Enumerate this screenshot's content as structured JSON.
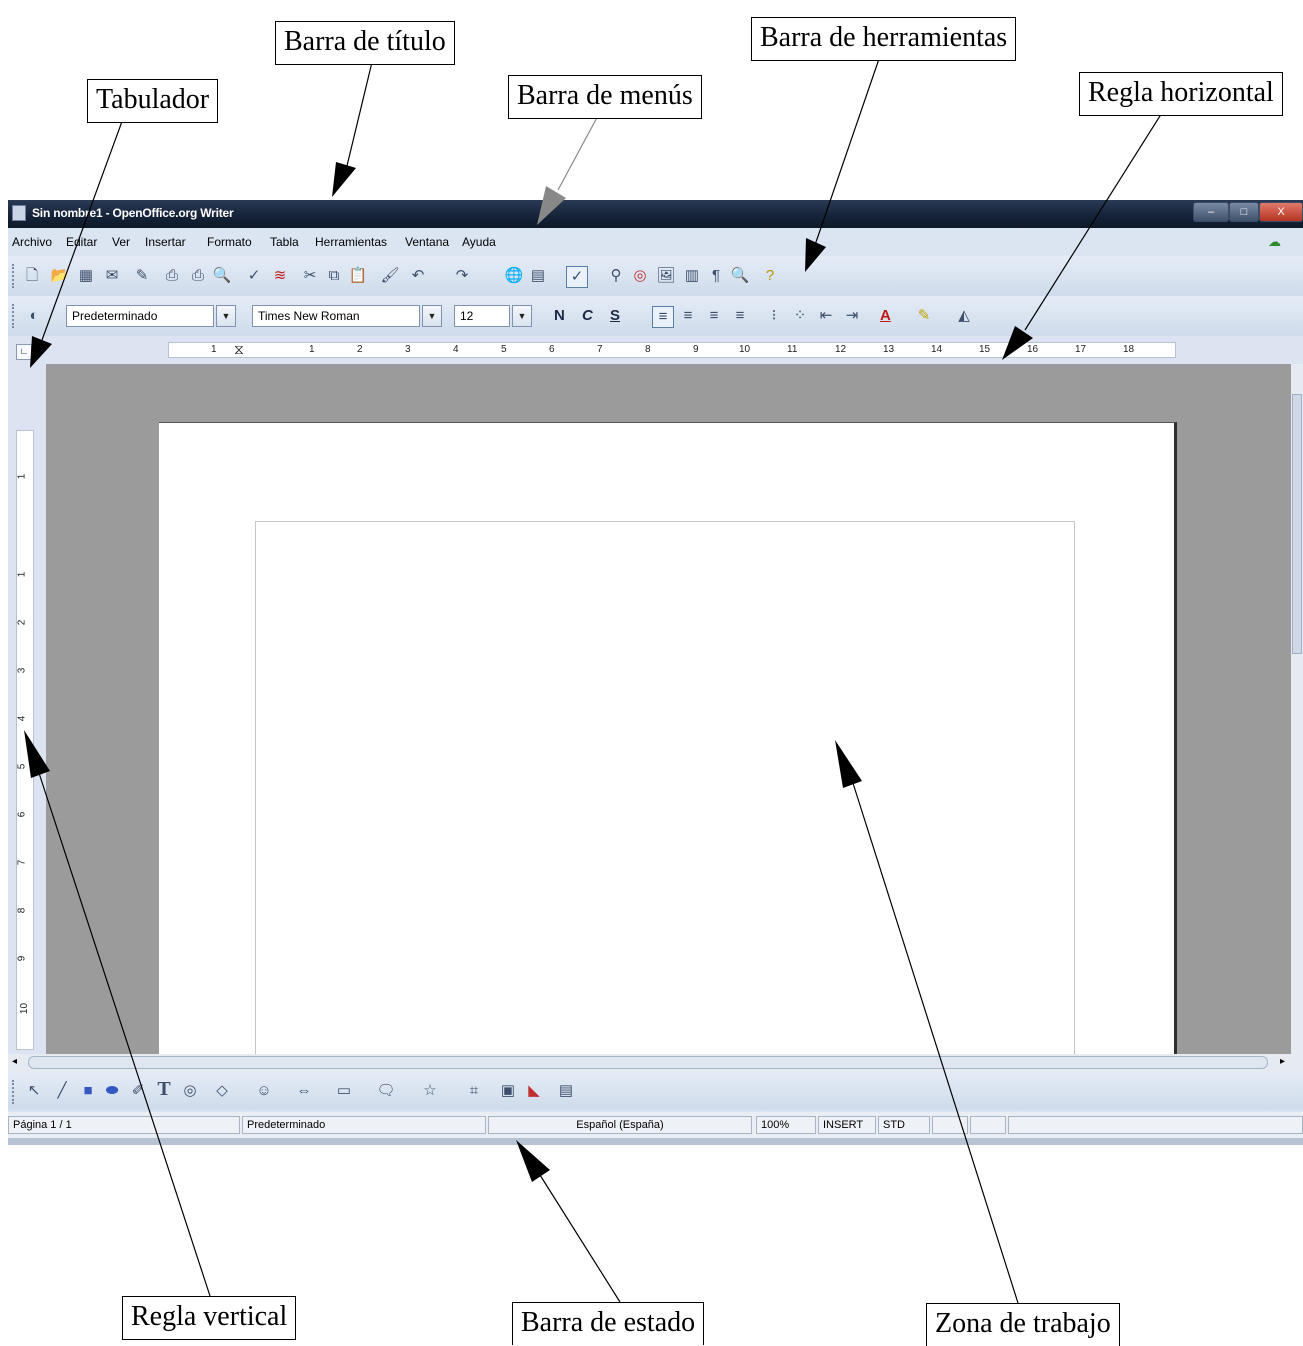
{
  "callouts": {
    "barra_titulo": "Barra de título",
    "barra_herramientas": "Barra de herramientas",
    "tabulador": "Tabulador",
    "barra_menus": "Barra de menús",
    "regla_horizontal": "Regla horizontal",
    "regla_vertical": "Regla vertical",
    "barra_estado": "Barra de estado",
    "zona_trabajo": "Zona de trabajo"
  },
  "window": {
    "title": "Sin nombre1 - OpenOffice.org Writer",
    "minimize_label": "–",
    "maximize_label": "□",
    "close_label": "X"
  },
  "menu": {
    "items": [
      "Archivo",
      "Editar",
      "Ver",
      "Insertar",
      "Formato",
      "Tabla",
      "Herramientas",
      "Ventana",
      "Ayuda"
    ]
  },
  "format_toolbar": {
    "style_value": "Predeterminado",
    "font_value": "Times New Roman",
    "size_value": "12",
    "bold_label": "N",
    "italic_label": "C",
    "underline_label": "S",
    "font_color_label": "A"
  },
  "hruler": {
    "numbers": [
      "1",
      "1",
      "2",
      "3",
      "4",
      "5",
      "6",
      "7",
      "8",
      "9",
      "10",
      "11",
      "12",
      "13",
      "14",
      "15",
      "16",
      "17",
      "18"
    ]
  },
  "vruler": {
    "numbers": [
      "1",
      "1",
      "2",
      "3",
      "4",
      "5",
      "6",
      "7",
      "8",
      "9",
      "10"
    ]
  },
  "statusbar": {
    "page": "Página 1 / 1",
    "style": "Predeterminado",
    "language": "Español (España)",
    "zoom": "100%",
    "insert_mode": "INSERT",
    "selection_mode": "STD"
  },
  "draw_toolbar": {
    "text_tool_label": "T"
  },
  "colors": {
    "titlebar": "#152238",
    "toolbar_bg": "#dbe5f2",
    "workspace_gray": "#9b9b9b",
    "page": "#ffffff"
  }
}
